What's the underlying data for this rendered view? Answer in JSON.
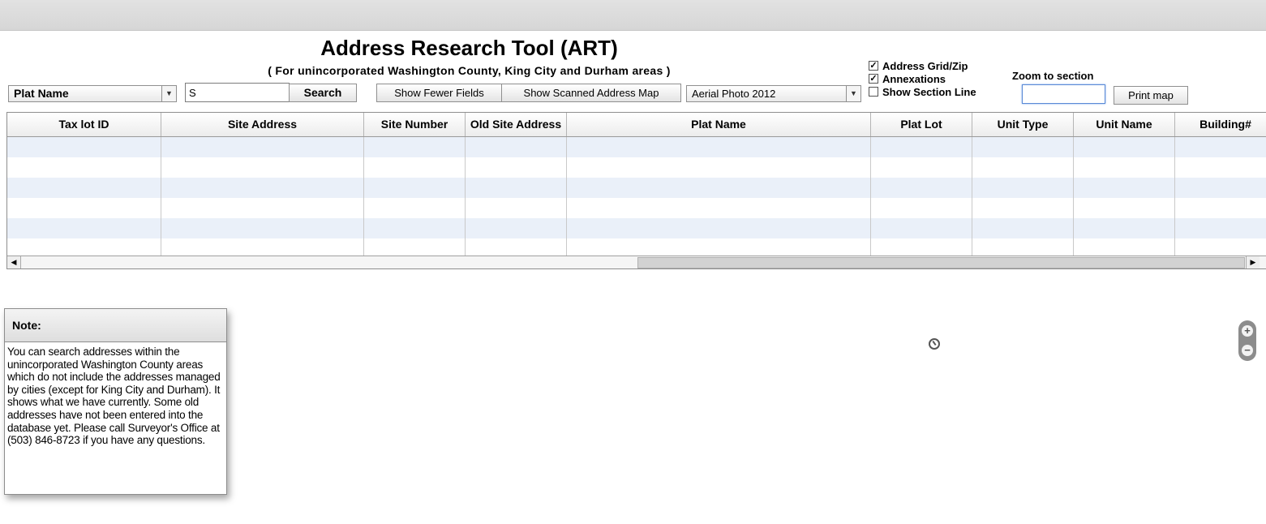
{
  "header": {
    "title": "Address Research Tool (ART)",
    "subtitle": "( For unincorporated Washington County, King City and Durham areas )"
  },
  "toolbar": {
    "search_field_select": "Plat Name",
    "search_value": "S",
    "search_label": "Search",
    "fewer_fields_label": "Show Fewer Fields",
    "scanned_map_label": "Show Scanned Address Map",
    "basemap_select": "Aerial Photo 2012",
    "print_label": "Print map"
  },
  "layers": {
    "address_grid": {
      "label": "Address Grid/Zip",
      "checked": true
    },
    "annexations": {
      "label": "Annexations",
      "checked": true
    },
    "section_line": {
      "label": "Show Section Line",
      "checked": false
    }
  },
  "zoom_section": {
    "label": "Zoom to section",
    "value": ""
  },
  "grid": {
    "columns": [
      "Tax lot ID",
      "Site Address",
      "Site Number",
      "Old Site Address",
      "Plat Name",
      "Plat Lot",
      "Unit Type",
      "Unit Name",
      "Building#"
    ],
    "rows": [
      [],
      [],
      [],
      [],
      [],
      []
    ]
  },
  "note": {
    "title": "Note:",
    "body": "You can search addresses within the unincorporated Washington County areas which do not include the addresses managed by cities (except for King City and Durham). It shows what we have  currently. Some old addresses have not been entered into the database yet. Please call Surveyor's Office at (503) 846-8723 if you have any questions."
  },
  "icons": {
    "map_measure": "measure-icon",
    "zoom_in": "zoom-in-icon",
    "zoom_out": "zoom-out-icon"
  }
}
